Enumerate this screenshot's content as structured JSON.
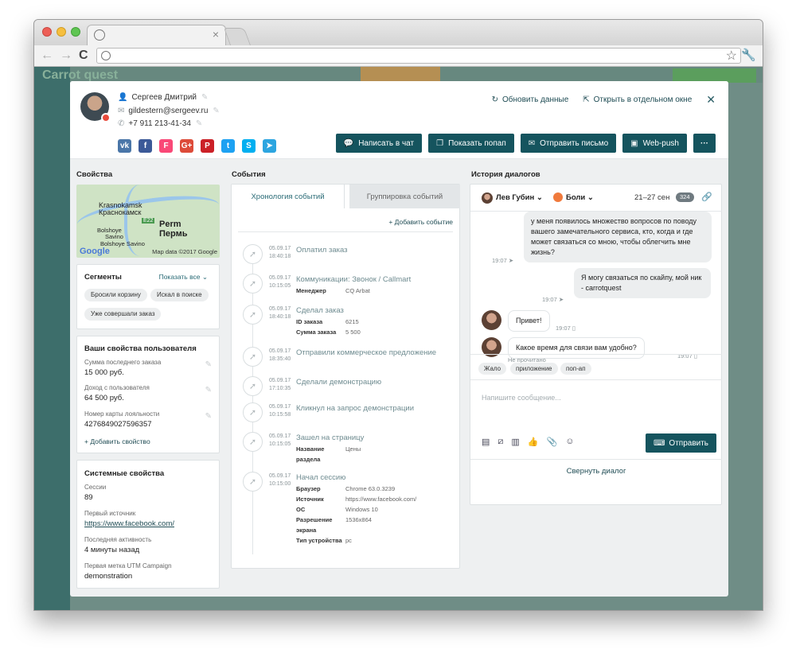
{
  "app": {
    "brand": "Carrot quest"
  },
  "contact": {
    "name": "Сергеев Дмитрий",
    "email": "gildestern@sergeev.ru",
    "phone": "+7 911 213-41-34"
  },
  "socials": [
    {
      "name": "vk-icon",
      "label": "vk",
      "color": "#4a76a8"
    },
    {
      "name": "facebook-icon",
      "label": "f",
      "color": "#3b5998"
    },
    {
      "name": "foursquare-icon",
      "label": "F",
      "color": "#f94877"
    },
    {
      "name": "googleplus-icon",
      "label": "G+",
      "color": "#dd4b39"
    },
    {
      "name": "pinterest-icon",
      "label": "P",
      "color": "#cb2027"
    },
    {
      "name": "twitter-icon",
      "label": "t",
      "color": "#1da1f2"
    },
    {
      "name": "skype-icon",
      "label": "S",
      "color": "#00aff0"
    },
    {
      "name": "telegram-icon",
      "label": "➤",
      "color": "#2ca5e0"
    }
  ],
  "header_links": {
    "refresh": "Обновить данные",
    "open_window": "Открыть в отдельном окне"
  },
  "actions": {
    "chat": "Написать в чат",
    "popup": "Показать попап",
    "email": "Отправить письмо",
    "webpush": "Web-push",
    "more": "···"
  },
  "properties": {
    "title": "Свойства",
    "map": {
      "city_en": "Perm",
      "city_ru": "Пермь",
      "city2_en": "Krasnokamsk",
      "city2_ru": "Краснокамск",
      "town1": "Bolshoye",
      "town2": "Savino",
      "town3": "Bolshoye Savino",
      "road": "E22",
      "google": "Google",
      "credit": "Map data ©2017 Google"
    },
    "segments": {
      "title": "Сегменты",
      "show_all": "Показать все",
      "chips": [
        "Бросили корзину",
        "Искал в поиске",
        "Уже совершали заказ"
      ]
    },
    "user": {
      "title": "Ваши свойства пользователя",
      "items": [
        {
          "label": "Сумма последнего заказа",
          "value": "15 000 руб."
        },
        {
          "label": "Доход с пользователя",
          "value": "64 500 руб."
        },
        {
          "label": "Номер карты лояльности",
          "value": "4276849027596357"
        }
      ],
      "add": "Добавить свойство"
    },
    "system": {
      "title": "Системные свойства",
      "items": [
        {
          "label": "Сессии",
          "value": "89"
        },
        {
          "label": "Первый источник",
          "value": "https://www.facebook.com/"
        },
        {
          "label": "Последняя активность",
          "value": "4 минуты назад"
        },
        {
          "label": "Первая метка UTM Campaign",
          "value": "demonstration"
        }
      ]
    }
  },
  "events": {
    "title": "События",
    "tabs": {
      "timeline": "Хронология событий",
      "grouping": "Группировка событий"
    },
    "add": "Добавить событие",
    "items": [
      {
        "date": "05.09.17",
        "time": "18:40:18",
        "title": "Оплатил заказ",
        "props": []
      },
      {
        "date": "05.09.17",
        "time": "10:15:05",
        "title": "Коммуникации: Звонок / Callmart",
        "props": [
          {
            "k": "Менеджер",
            "v": "CQ Arbat"
          }
        ]
      },
      {
        "date": "05.09.17",
        "time": "18:40:18",
        "title": "Сделал заказ",
        "props": [
          {
            "k": "ID заказа",
            "v": "6215"
          },
          {
            "k": "Сумма заказа",
            "v": "5 500"
          }
        ]
      },
      {
        "date": "05.09.17",
        "time": "18:35:40",
        "title": "Отправили коммерческое предложение",
        "props": []
      },
      {
        "date": "05.09.17",
        "time": "17:10:35",
        "title": "Сделали демонстрацию",
        "props": []
      },
      {
        "date": "05.09.17",
        "time": "10:15:58",
        "title": "Кликнул на запрос демонстрации",
        "props": []
      },
      {
        "date": "05.09.17",
        "time": "10:15:05",
        "title": "Зашел на страницу",
        "props": [
          {
            "k": "Название",
            "v": "Цены"
          },
          {
            "k": "раздела",
            "v": ""
          }
        ]
      },
      {
        "date": "05.09.17",
        "time": "10:15:00",
        "title": "Начал сессию",
        "props": [
          {
            "k": "Браузер",
            "v": "Chrome 63.0.3239"
          },
          {
            "k": "Источник",
            "v": "https://www.facebook.com/"
          },
          {
            "k": "ОС",
            "v": "Windows 10"
          },
          {
            "k": "Разрешение",
            "v": "1536x864"
          },
          {
            "k": "экрана",
            "v": ""
          },
          {
            "k": "Тип устройства",
            "v": "pc"
          }
        ]
      }
    ]
  },
  "dialogs": {
    "title": "История диалогов",
    "agent": "Лев Губин",
    "channel": "Боли",
    "range": "21–27 сен",
    "count": "324",
    "messages": [
      {
        "text": "у меня появилось множество вопросов по поводу вашего замечательного сервиса, кто, когда и где может связаться со мною, чтобы облегчить мне жизнь?",
        "time": "19:07"
      },
      {
        "text": "Я могу связаться по скайпу, мой ник - carrotquest",
        "time": "19:07"
      },
      {
        "text": "Привет!",
        "time": "19:07"
      },
      {
        "text": "Какое время для связи вам удобно?",
        "time": "19:07"
      }
    ],
    "unread": "Не прочитано",
    "tags": [
      "Жало",
      "приложение",
      "поп-ап"
    ],
    "placeholder": "Напишите сообщение...",
    "send": "Отправить",
    "collapse": "Свернуть диалог"
  }
}
